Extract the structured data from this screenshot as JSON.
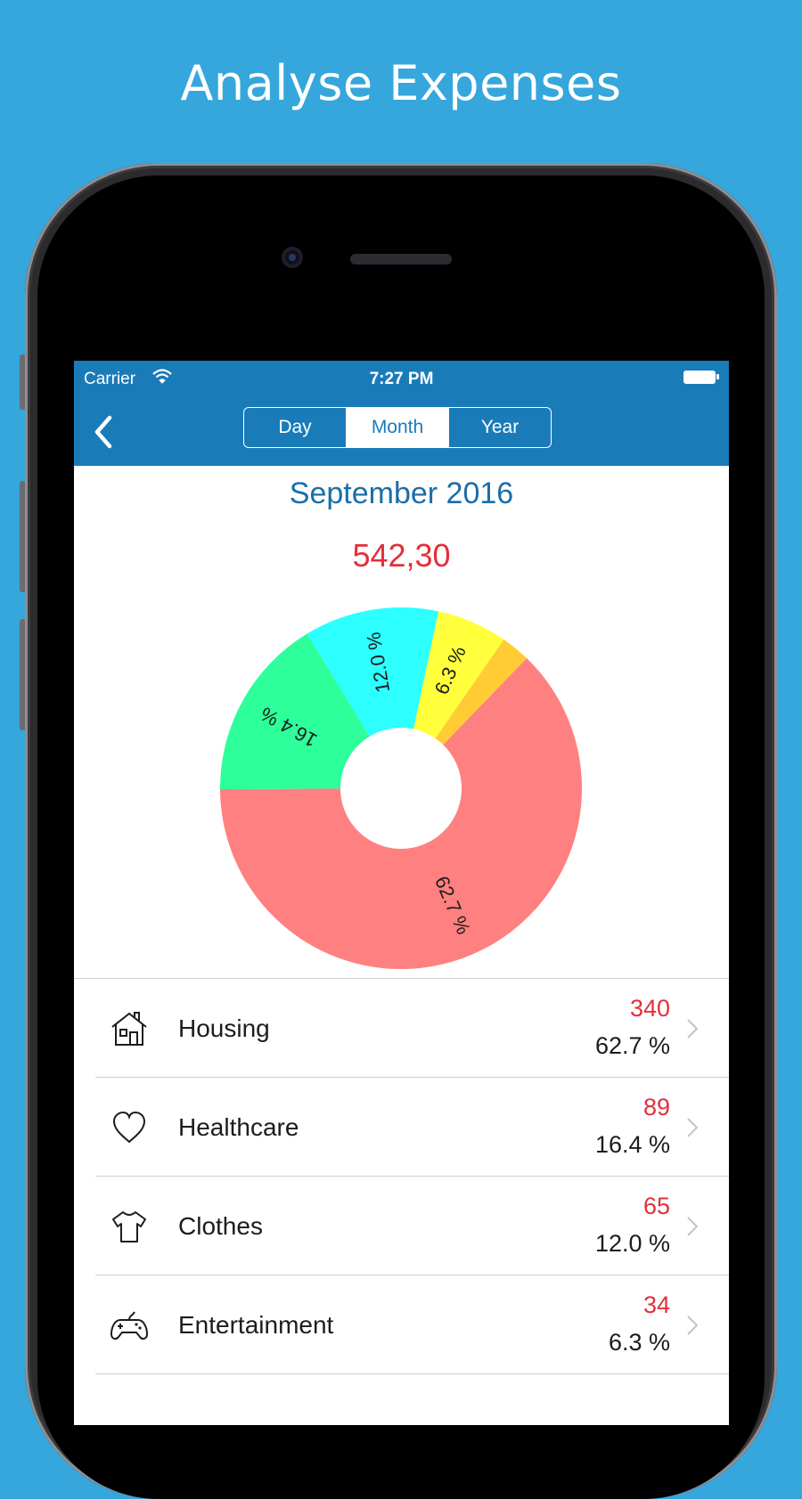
{
  "headline": "Analyse Expenses",
  "status_bar": {
    "carrier": "Carrier",
    "time": "7:27 PM"
  },
  "nav": {
    "segments": [
      {
        "label": "Day"
      },
      {
        "label": "Month"
      },
      {
        "label": "Year"
      }
    ],
    "active_segment": "Month"
  },
  "summary": {
    "period": "September 2016",
    "total": "542,30"
  },
  "colors": {
    "brand": "#1a7bb9",
    "background": "#35a7dc",
    "amount": "#e2303a"
  },
  "chart_data": {
    "type": "pie",
    "donut": true,
    "slices": [
      {
        "label": "62.7 %",
        "value": 62.7,
        "color": "#ff8080"
      },
      {
        "label": "16.4 %",
        "value": 16.4,
        "color": "#2dff9a"
      },
      {
        "label": "12.0 %",
        "value": 12.0,
        "color": "#2dffff"
      },
      {
        "label": "6.3 %",
        "value": 6.3,
        "color": "#ffff3b"
      },
      {
        "label": "",
        "value": 2.6,
        "color": "#ffcc33"
      }
    ]
  },
  "categories": [
    {
      "name": "Housing",
      "amount": "340",
      "percent": "62.7 %",
      "icon": "house-icon"
    },
    {
      "name": "Healthcare",
      "amount": "89",
      "percent": "16.4 %",
      "icon": "heart-icon"
    },
    {
      "name": "Clothes",
      "amount": "65",
      "percent": "12.0 %",
      "icon": "tshirt-icon"
    },
    {
      "name": "Entertainment",
      "amount": "34",
      "percent": "6.3 %",
      "icon": "gamepad-icon"
    }
  ]
}
